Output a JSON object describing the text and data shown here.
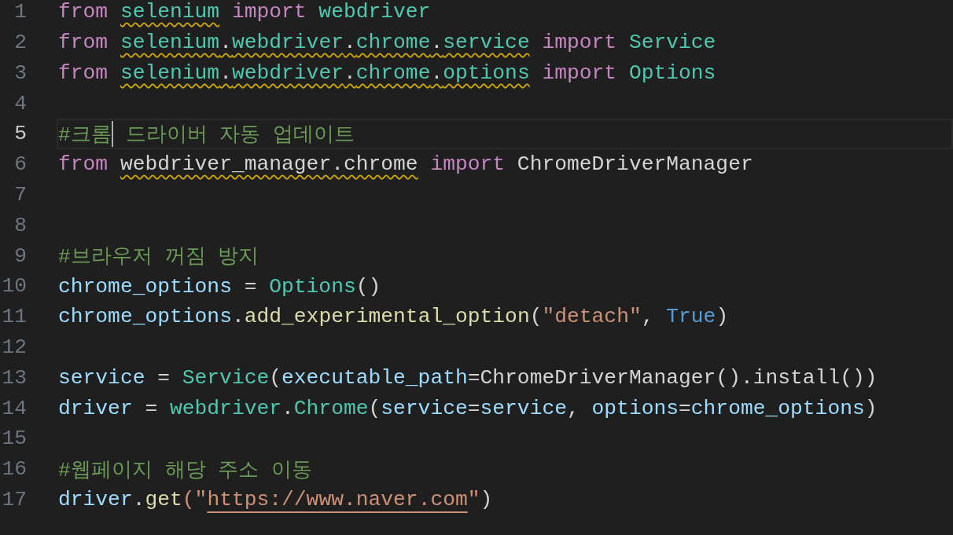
{
  "editor": {
    "lines": [
      {
        "number": "1",
        "current": false,
        "tokens": [
          {
            "text": "from",
            "kind": "keyword",
            "spaced": false,
            "warning": false
          },
          {
            "text": "selenium",
            "kind": "module",
            "spaced": true,
            "warning": true
          },
          {
            "text": "import",
            "kind": "keyword",
            "spaced": true,
            "warning": false
          },
          {
            "text": "webdriver",
            "kind": "module",
            "spaced": true,
            "warning": false
          }
        ]
      },
      {
        "number": "2",
        "current": false,
        "tokens": [
          {
            "text": "from",
            "kind": "keyword",
            "spaced": false,
            "warning": false
          },
          {
            "text": "selenium",
            "kind": "module",
            "spaced": true,
            "warning": true
          },
          {
            "text": ".",
            "kind": "plain",
            "spaced": false,
            "warning": true
          },
          {
            "text": "webdriver",
            "kind": "module",
            "spaced": false,
            "warning": true
          },
          {
            "text": ".",
            "kind": "plain",
            "spaced": false,
            "warning": true
          },
          {
            "text": "chrome",
            "kind": "module",
            "spaced": false,
            "warning": true
          },
          {
            "text": ".",
            "kind": "plain",
            "spaced": false,
            "warning": true
          },
          {
            "text": "service",
            "kind": "module",
            "spaced": false,
            "warning": true
          },
          {
            "text": "import",
            "kind": "keyword",
            "spaced": true,
            "warning": false
          },
          {
            "text": "Service",
            "kind": "class",
            "spaced": true,
            "warning": false
          }
        ]
      },
      {
        "number": "3",
        "current": false,
        "tokens": [
          {
            "text": "from",
            "kind": "keyword",
            "spaced": false,
            "warning": false
          },
          {
            "text": "selenium",
            "kind": "module",
            "spaced": true,
            "warning": true
          },
          {
            "text": ".",
            "kind": "plain",
            "spaced": false,
            "warning": true
          },
          {
            "text": "webdriver",
            "kind": "module",
            "spaced": false,
            "warning": true
          },
          {
            "text": ".",
            "kind": "plain",
            "spaced": false,
            "warning": true
          },
          {
            "text": "chrome",
            "kind": "module",
            "spaced": false,
            "warning": true
          },
          {
            "text": ".",
            "kind": "plain",
            "spaced": false,
            "warning": true
          },
          {
            "text": "options",
            "kind": "module",
            "spaced": false,
            "warning": true
          },
          {
            "text": "import",
            "kind": "keyword",
            "spaced": true,
            "warning": false
          },
          {
            "text": "Options",
            "kind": "class",
            "spaced": true,
            "warning": false
          }
        ]
      },
      {
        "number": "4",
        "current": false
      },
      {
        "number": "5",
        "current": true,
        "tokens": [
          {
            "text": "#크롬",
            "kind": "comment",
            "spaced": false,
            "warning": false
          },
          {
            "kind": "caret"
          },
          {
            "text": "드라이버 자동 업데이트",
            "kind": "comment",
            "spaced": true,
            "warning": false
          }
        ]
      },
      {
        "number": "6",
        "current": false,
        "tokens": [
          {
            "text": "from",
            "kind": "keyword",
            "spaced": false,
            "warning": false
          },
          {
            "text": "webdriver_manager.chrome",
            "kind": "plain",
            "spaced": true,
            "warning": true
          },
          {
            "text": "import",
            "kind": "keyword",
            "spaced": true,
            "warning": false
          },
          {
            "text": "ChromeDriverManager",
            "kind": "plain",
            "spaced": true,
            "warning": false
          }
        ]
      },
      {
        "number": "7",
        "current": false
      },
      {
        "number": "8",
        "current": false
      },
      {
        "number": "9",
        "current": false,
        "tokens": [
          {
            "text": "#브라우저 꺼짐 방지",
            "kind": "comment",
            "spaced": false,
            "warning": false
          }
        ]
      },
      {
        "number": "10",
        "current": false,
        "tokens": [
          {
            "text": "chrome_options",
            "kind": "variable",
            "spaced": false,
            "warning": false
          },
          {
            "text": "=",
            "kind": "plain",
            "spaced": true,
            "warning": false
          },
          {
            "text": "Options",
            "kind": "class",
            "spaced": true,
            "warning": false
          },
          {
            "text": "()",
            "kind": "plain",
            "spaced": false,
            "warning": false
          }
        ]
      },
      {
        "number": "11",
        "current": false,
        "tokens": [
          {
            "text": "chrome_options",
            "kind": "variable",
            "spaced": false,
            "warning": false
          },
          {
            "text": ".",
            "kind": "plain",
            "spaced": false,
            "warning": false
          },
          {
            "text": "add_experimental_option",
            "kind": "function",
            "spaced": false,
            "warning": false
          },
          {
            "text": "(",
            "kind": "plain",
            "spaced": false,
            "warning": false
          },
          {
            "text": "\"detach\"",
            "kind": "string",
            "spaced": false,
            "warning": false
          },
          {
            "text": ",",
            "kind": "plain",
            "spaced": false,
            "warning": false
          },
          {
            "text": "True",
            "kind": "bool",
            "spaced": true,
            "warning": false
          },
          {
            "text": ")",
            "kind": "plain",
            "spaced": false,
            "warning": false
          }
        ]
      },
      {
        "number": "12",
        "current": false
      },
      {
        "number": "13",
        "current": false,
        "tokens": [
          {
            "text": "service",
            "kind": "variable",
            "spaced": false,
            "warning": false
          },
          {
            "text": "=",
            "kind": "plain",
            "spaced": true,
            "warning": false
          },
          {
            "text": "Service",
            "kind": "class",
            "spaced": true,
            "warning": false
          },
          {
            "text": "(",
            "kind": "plain",
            "spaced": false,
            "warning": false
          },
          {
            "text": "executable_path",
            "kind": "variable",
            "spaced": false,
            "warning": false
          },
          {
            "text": "=ChromeDriverManager().install())",
            "kind": "plain",
            "spaced": false,
            "warning": false
          }
        ]
      },
      {
        "number": "14",
        "current": false,
        "tokens": [
          {
            "text": "driver",
            "kind": "variable",
            "spaced": false,
            "warning": false
          },
          {
            "text": "=",
            "kind": "plain",
            "spaced": true,
            "warning": false
          },
          {
            "text": "webdriver",
            "kind": "module",
            "spaced": true,
            "warning": false
          },
          {
            "text": ".",
            "kind": "plain",
            "spaced": false,
            "warning": false
          },
          {
            "text": "Chrome",
            "kind": "class",
            "spaced": false,
            "warning": false
          },
          {
            "text": "(",
            "kind": "plain",
            "spaced": false,
            "warning": false
          },
          {
            "text": "service",
            "kind": "variable",
            "spaced": false,
            "warning": false
          },
          {
            "text": "=",
            "kind": "plain",
            "spaced": false,
            "warning": false
          },
          {
            "text": "service",
            "kind": "variable",
            "spaced": false,
            "warning": false
          },
          {
            "text": ",",
            "kind": "plain",
            "spaced": false,
            "warning": false
          },
          {
            "text": "options",
            "kind": "variable",
            "spaced": true,
            "warning": false
          },
          {
            "text": "=",
            "kind": "plain",
            "spaced": false,
            "warning": false
          },
          {
            "text": "chrome_options",
            "kind": "variable",
            "spaced": false,
            "warning": false
          },
          {
            "text": ")",
            "kind": "plain",
            "spaced": false,
            "warning": false
          }
        ]
      },
      {
        "number": "15",
        "current": false
      },
      {
        "number": "16",
        "current": false,
        "tokens": [
          {
            "text": "#웹페이지 해당 주소 이동",
            "kind": "comment",
            "spaced": false,
            "warning": false
          }
        ]
      },
      {
        "number": "17",
        "current": false,
        "tokens": [
          {
            "text": "driver",
            "kind": "variable",
            "spaced": false,
            "warning": false
          },
          {
            "text": ".",
            "kind": "plain",
            "spaced": false,
            "warning": false
          },
          {
            "text": "get",
            "kind": "function",
            "spaced": false,
            "warning": false
          },
          {
            "text": "(\"",
            "kind": "string",
            "spaced": false,
            "warning": false
          },
          {
            "text": "https://www.naver.com",
            "kind": "url",
            "spaced": false,
            "warning": false
          },
          {
            "text": "\"",
            "kind": "string",
            "spaced": false,
            "warning": false
          },
          {
            "text": ")",
            "kind": "plain",
            "spaced": false,
            "warning": false
          }
        ]
      }
    ]
  }
}
